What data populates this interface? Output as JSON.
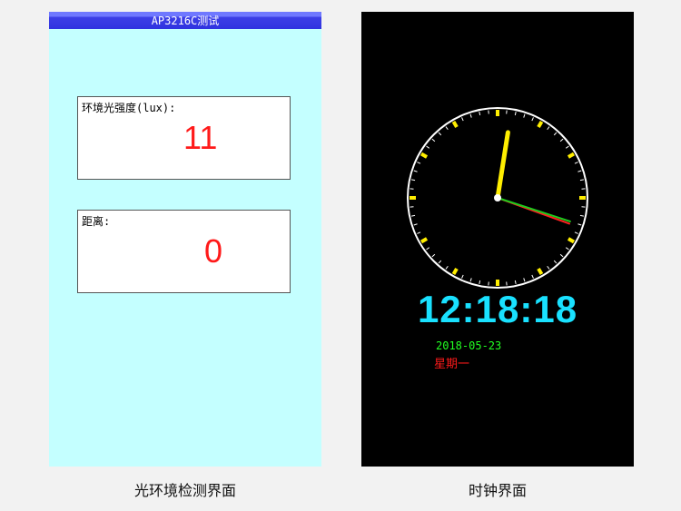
{
  "left_screen": {
    "title": "AP3216C测试",
    "light_panel": {
      "label": "环境光强度(lux):",
      "value": "11"
    },
    "distance_panel": {
      "label": "距离:",
      "value": "0"
    },
    "caption": "光环境检测界面",
    "colors": {
      "background": "#c4ffff",
      "titlebar": "#2f33e0",
      "value": "#ff1a1a"
    }
  },
  "right_screen": {
    "clock": {
      "hour": 12,
      "minute": 18,
      "second": 18
    },
    "digital_time": "12:18:18",
    "date": "2018-05-23",
    "weekday": "星期一",
    "caption": "时钟界面",
    "colors": {
      "background": "#000000",
      "hour_hand": "#ffee00",
      "minute_hand": "#ff2020",
      "second_hand": "#1ecc1e",
      "digital_time": "#19e1ff",
      "date": "#22ff22",
      "weekday": "#ff1a1a"
    }
  }
}
